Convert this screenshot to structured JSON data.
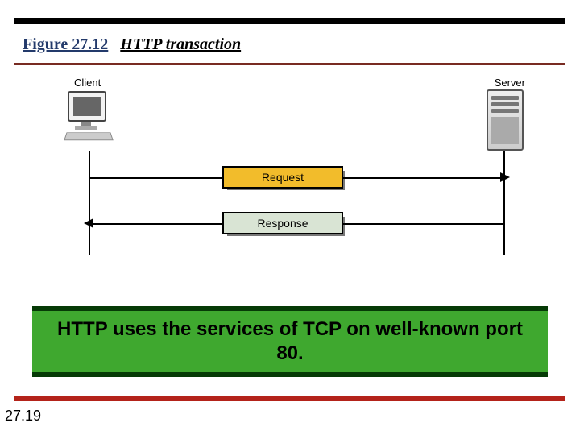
{
  "heading": {
    "figure_number": "Figure 27.12",
    "figure_title": "HTTP transaction"
  },
  "diagram": {
    "client_label": "Client",
    "server_label": "Server",
    "request_label": "Request",
    "response_label": "Response"
  },
  "callout": {
    "text": "HTTP uses the services of TCP on well-known port 80."
  },
  "footer": {
    "slide_number": "27.19"
  }
}
